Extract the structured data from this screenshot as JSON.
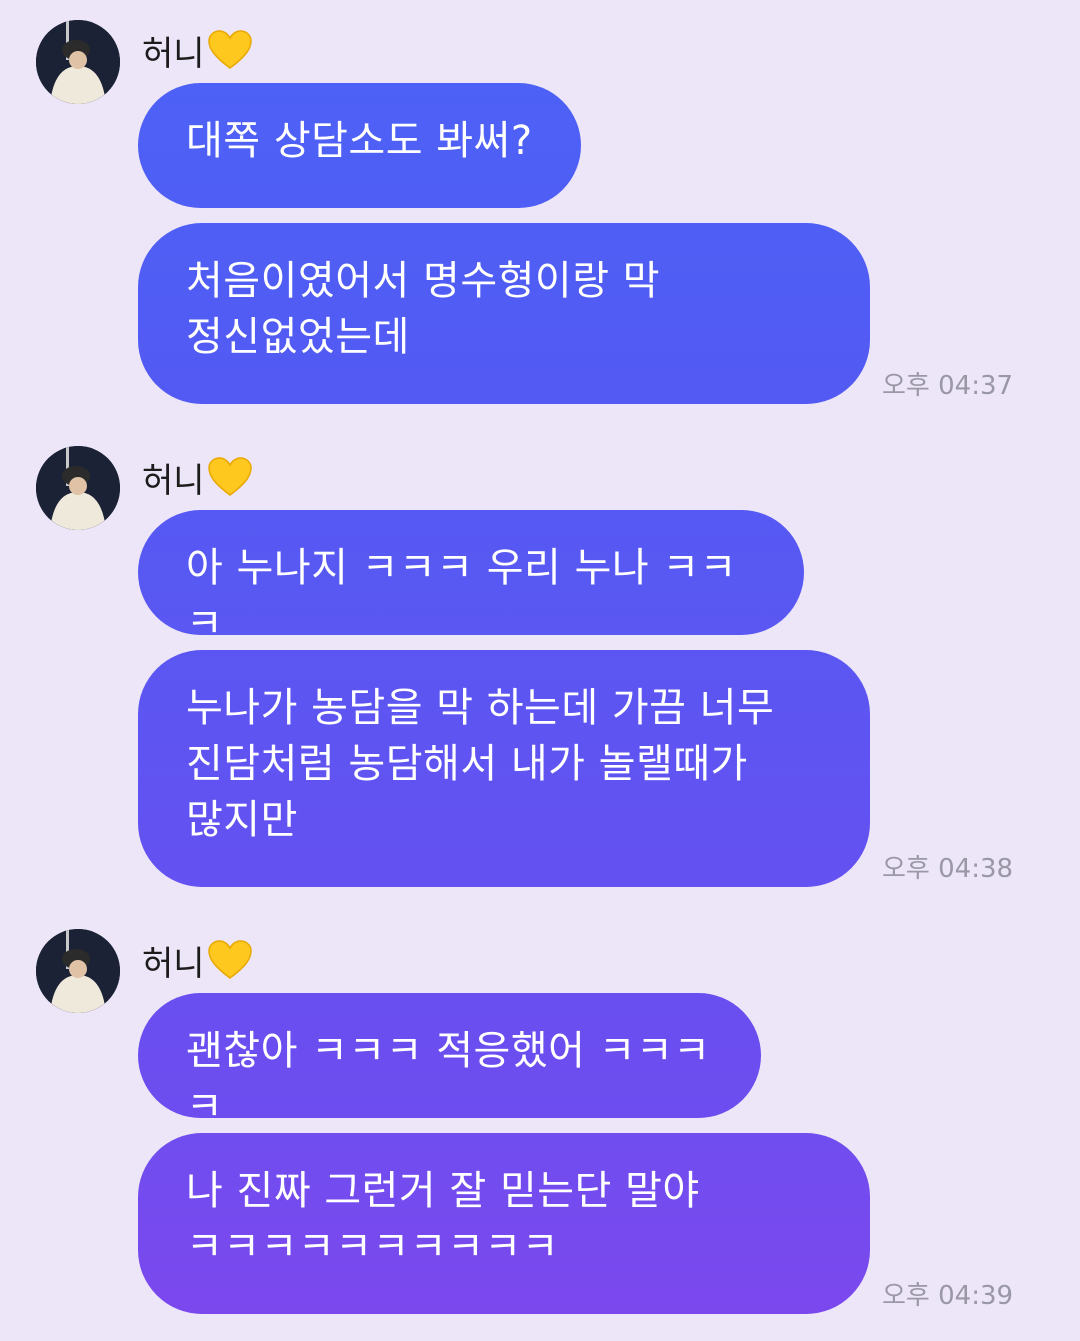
{
  "chat": {
    "groups": [
      {
        "sender": "허니",
        "sender_emoji": "yellow-heart-icon",
        "messages": [
          {
            "text": "대쪽 상담소도 봐써?"
          },
          {
            "text": "처음이였어서 명수형이랑 막\n정신없었는데",
            "time": "오후 04:37"
          }
        ]
      },
      {
        "sender": "허니",
        "sender_emoji": "yellow-heart-icon",
        "messages": [
          {
            "text": "아 누나지 ㅋㅋㅋ 우리 누나 ㅋㅋㅋ"
          },
          {
            "text": "누나가 농담을 막 하는데 가끔 너무\n진담처럼 농담해서 내가 놀랠때가\n많지만",
            "time": "오후 04:38"
          }
        ]
      },
      {
        "sender": "허니",
        "sender_emoji": "yellow-heart-icon",
        "messages": [
          {
            "text": "괜찮아 ㅋㅋㅋ 적응했어 ㅋㅋㅋㅋ"
          },
          {
            "text": "나 진짜 그런거 잘 믿는단 말야\nㅋㅋㅋㅋㅋㅋㅋㅋㅋㅋ",
            "time": "오후 04:39"
          }
        ]
      }
    ]
  },
  "colors": {
    "background": "#ede6f8",
    "bubble_gradient_top": "#4f5ff5",
    "bubble_gradient_bottom": "#7d4cee",
    "timestamp": "#9a97a6",
    "heart": "#ffc81e"
  }
}
